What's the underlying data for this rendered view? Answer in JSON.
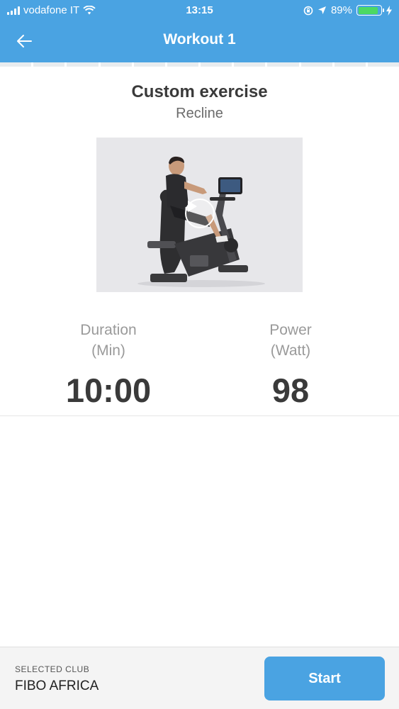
{
  "status_bar": {
    "carrier": "vodafone IT",
    "time": "13:15",
    "battery": "89%",
    "battery_level": 0.89,
    "icons": [
      "signal-icon",
      "wifi-icon",
      "lock-rotation-icon",
      "location-icon",
      "battery-icon",
      "charging-icon"
    ]
  },
  "nav": {
    "title": "Workout 1",
    "back_icon": "arrow-left-icon"
  },
  "exercise": {
    "name": "Custom exercise",
    "equipment": "Recline",
    "media_icon": "play-icon"
  },
  "stats": {
    "duration": {
      "label": "Duration",
      "unit": "(Min)",
      "value": "10:00"
    },
    "power": {
      "label": "Power",
      "unit": "(Watt)",
      "value": "98"
    }
  },
  "footer": {
    "club_label": "SELECTED CLUB",
    "club_name": "FIBO AFRICA",
    "start_label": "Start"
  },
  "colors": {
    "accent": "#4aa3e2",
    "battery_fill": "#4cd964"
  }
}
